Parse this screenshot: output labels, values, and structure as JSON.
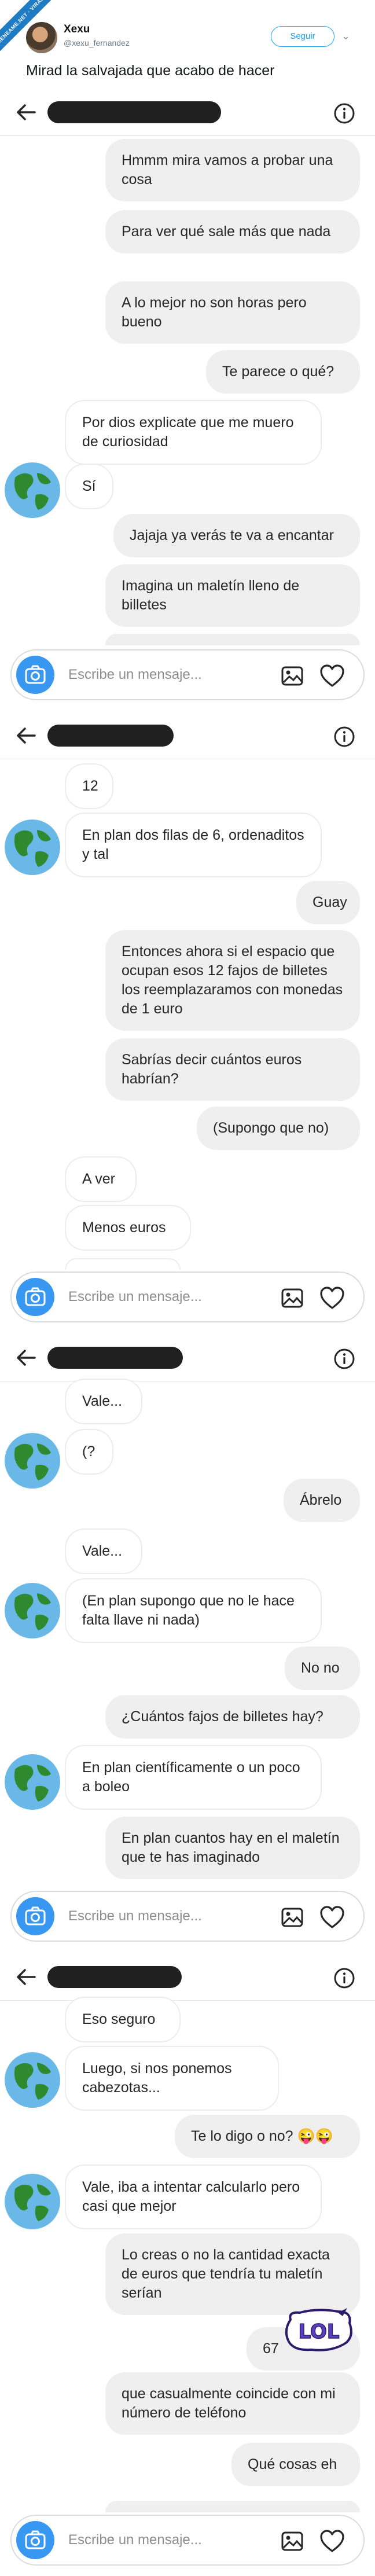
{
  "tweet": {
    "ribbon": "MENEAME.NET · VIRAL",
    "author_name": "Xexu",
    "author_handle": "@xexu_fernandez",
    "follow_label": "Seguir",
    "text": "Mirad la salvajada que acabo de hacer"
  },
  "composer": {
    "placeholder": "Escribe un mensaje..."
  },
  "panels": [
    {
      "messages": [
        {
          "side": "out",
          "text": "Hmmm mira vamos a probar una cosa"
        },
        {
          "side": "out",
          "text": "Para ver qué sale más que nada"
        },
        {
          "side": "out",
          "text": "A lo mejor no son horas pero bueno"
        },
        {
          "side": "out",
          "text": "Te parece o qué?"
        },
        {
          "side": "in",
          "text": "Por dios explicate que me muero de curiosidad"
        },
        {
          "side": "in",
          "text": "Sí"
        },
        {
          "side": "out",
          "text": "Jajaja ya verás te va a encantar"
        },
        {
          "side": "out",
          "text": "Imagina un maletín lleno de billetes"
        }
      ]
    },
    {
      "messages": [
        {
          "side": "in",
          "text": "12"
        },
        {
          "side": "in",
          "text": "En plan dos filas de 6, ordenaditos y tal"
        },
        {
          "side": "out",
          "text": "Guay"
        },
        {
          "side": "out",
          "text": "Entonces ahora si el espacio que ocupan esos 12 fajos de billetes los reemplazaramos con monedas de 1 euro"
        },
        {
          "side": "out",
          "text": "Sabrías decir cuántos euros habrían?"
        },
        {
          "side": "out",
          "text": "(Supongo que no)"
        },
        {
          "side": "in",
          "text": "A ver"
        },
        {
          "side": "in",
          "text": "Menos euros"
        }
      ]
    },
    {
      "messages": [
        {
          "side": "in",
          "text": "Vale..."
        },
        {
          "side": "in",
          "text": "(?"
        },
        {
          "side": "out",
          "text": "Ábrelo"
        },
        {
          "side": "in",
          "text": "Vale..."
        },
        {
          "side": "in",
          "text": "(En plan supongo que no le hace falta llave ni nada)"
        },
        {
          "side": "out",
          "text": "No no"
        },
        {
          "side": "out",
          "text": "¿Cuántos fajos de billetes hay?"
        },
        {
          "side": "in",
          "text": "En plan científicamente o un poco a boleo"
        },
        {
          "side": "out",
          "text": "En plan cuantos hay en el maletín que te has imaginado"
        }
      ]
    },
    {
      "messages": [
        {
          "side": "in",
          "text": "Eso seguro"
        },
        {
          "side": "in",
          "text": "Luego, si nos ponemos cabezotas..."
        },
        {
          "side": "out",
          "text": "Te lo digo o no? 😜😜"
        },
        {
          "side": "in",
          "text": "Vale, iba a intentar calcularlo pero casi que mejor"
        },
        {
          "side": "out",
          "text": "Lo creas o no la cantidad exacta de euros que tendría tu maletín serían"
        },
        {
          "side": "out",
          "text": "67"
        },
        {
          "side": "out",
          "text": "que casualmente coincide con mi número de teléfono"
        },
        {
          "side": "out",
          "text": "Qué cosas eh"
        }
      ]
    }
  ],
  "sticker": {
    "text": "LOL"
  }
}
